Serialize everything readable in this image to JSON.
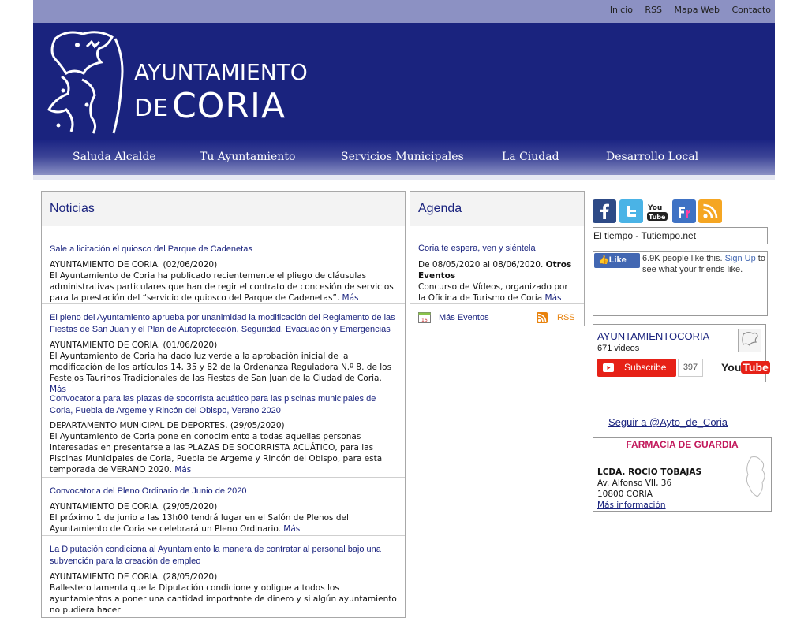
{
  "top_links": [
    "Inicio",
    "RSS",
    "Mapa Web",
    "Contacto"
  ],
  "logo": {
    "line1": "AYUNTAMIENTO",
    "line2_de": "DE",
    "line2_main": "CORIA"
  },
  "nav": [
    "Saluda Alcalde",
    "Tu Ayuntamiento",
    "Servicios Municipales",
    "La Ciudad",
    "Desarrollo Local"
  ],
  "news": {
    "heading": "Noticias",
    "items": [
      {
        "title": "Sale a licitación el quiosco del Parque de Cadenetas",
        "source": "AYUNTAMIENTO DE CORIA. (02/06/2020)",
        "body": "El Ayuntamiento de Coria ha publicado recientemente el pliego de cláusulas administrativas particulares que han de regir el contrato de concesión de servicios para la prestación del “servicio de quiosco del Parque de Cadenetas”.",
        "more": "Más"
      },
      {
        "title": "El pleno del Ayuntamiento aprueba por unanimidad la modificación del Reglamento de las Fiestas de San Juan y el Plan de Autoprotección, Seguridad, Evacuación y Emergencias",
        "source": "AYUNTAMIENTO DE CORIA. (01/06/2020)",
        "body": "El Ayuntamiento de Coria ha dado luz verde a la aprobación inicial de la modificación de los artículos 14, 35 y 82 de la Ordenanza Reguladora N.º 8. de los Festejos Taurinos Tradicionales de las Fiestas de San Juan de la Ciudad de Coria.",
        "more": "Más"
      },
      {
        "title": "Convocatoria para las plazas de socorrista acuático para las piscinas municipales de Coria, Puebla de Argeme y Rincón del Obispo, Verano 2020",
        "source": "DEPARTAMENTO MUNICIPAL DE DEPORTES. (29/05/2020)",
        "body": "El Ayuntamiento de Coria pone en conocimiento a todas aquellas personas interesadas en presentarse a las PLAZAS DE SOCORRISTA ACUÁTICO, para las Piscinas Municipales de Coria, Puebla de Argeme y Rincón del Obispo, para esta temporada de VERANO 2020.",
        "more": "Más"
      },
      {
        "title": "Convocatoria del Pleno Ordinario de Junio de 2020",
        "source": "AYUNTAMIENTO DE CORIA. (29/05/2020)",
        "body": "El próximo 1 de junio a las 13h00 tendrá lugar en el Salón de Plenos del Ayuntamiento de Coria se celebrará un Pleno Ordinario.",
        "more": "Más"
      },
      {
        "title": "La Diputación condiciona al Ayuntamiento la manera de contratar al personal bajo una subvención para la creación de empleo",
        "source": "AYUNTAMIENTO DE CORIA. (28/05/2020)",
        "body": "Ballestero lamenta que la Diputación condicione y obligue a todos los ayuntamientos a poner una cantidad importante de dinero y si algún ayuntamiento no pudiera hacer",
        "more": ""
      }
    ]
  },
  "agenda": {
    "heading": "Agenda",
    "event_title": "Coria te espera, ven y siéntela",
    "event_dates": "De 08/05/2020 al 08/06/2020.",
    "event_type": "Otros Eventos",
    "event_body": "Concurso de Vídeos, organizado por la Oficina de Turismo de Coria",
    "more": "Más",
    "more_events": "Más Eventos",
    "rss": "RSS",
    "calendar_day": "16"
  },
  "social": [
    "facebook-icon",
    "twitter-icon",
    "youtube-icon",
    "flickr-icon",
    "rss-icon"
  ],
  "weather": "El tiempo - Tutiempo.net",
  "facebook": {
    "like": "Like",
    "text_pre": "6.9K people like this. ",
    "signup": "Sign Up",
    "text_post": " to see what your friends like."
  },
  "youtube": {
    "channel": "AYUNTAMIENTOCORIA",
    "videos": "671 videos",
    "subscribe": "Subscribe",
    "subs": "397",
    "logo_you": "You",
    "logo_tube": "Tube"
  },
  "twitter_follow": "Seguir a @Ayto_de_Coria",
  "pharmacy": {
    "title": "FARMACIA DE GUARDIA",
    "name": "LCDA. ROCÍO TOBAJAS",
    "address": "Av. Alfonso VII, 36",
    "city": "10800 CORIA",
    "more": "Más información"
  },
  "colors": {
    "header": "#1a237e",
    "topbar": "#8c91c3",
    "link": "#1a237e",
    "pharmacy_title": "#c2185b"
  }
}
